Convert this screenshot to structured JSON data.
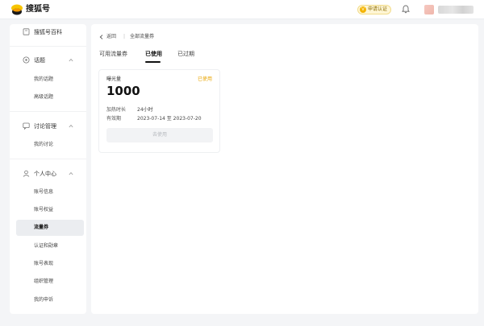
{
  "header": {
    "brand": "搜狐号",
    "certify_label": "申请认证"
  },
  "sidebar": {
    "top_item": "搜狐号百科",
    "sections": [
      {
        "label": "话题",
        "items": [
          "我的话题",
          "高级话题"
        ]
      },
      {
        "label": "讨论管理",
        "items": [
          "我的讨论"
        ]
      },
      {
        "label": "个人中心",
        "items": [
          "账号信息",
          "账号权益",
          "流量券",
          "认证和勋章",
          "账号表现",
          "组织管理",
          "我的申诉"
        ]
      }
    ],
    "active_item": "流量券"
  },
  "breadcrumb": {
    "back": "返回",
    "separator": "|",
    "current": "全部流量券"
  },
  "tabs": [
    {
      "label": "可用流量券",
      "active": false
    },
    {
      "label": "已使用",
      "active": true
    },
    {
      "label": "已过期",
      "active": false
    }
  ],
  "coupon": {
    "kind": "曝光量",
    "status": "已使用",
    "amount": "1000",
    "duration_label": "加热时长",
    "duration_value": "24小时",
    "validity_label": "有效期",
    "validity_value": "2023-07-14 至 2023-07-20",
    "button_label": "去使用"
  },
  "colors": {
    "accent_yellow": "#e8a400",
    "page_bg": "#f4f5f7",
    "active_item_bg": "#ebedf0"
  },
  "icons": {
    "logo": "sohu-logo-icon",
    "certify": "v-badge-icon",
    "bell": "bell-icon",
    "back": "chevron-left-icon"
  }
}
